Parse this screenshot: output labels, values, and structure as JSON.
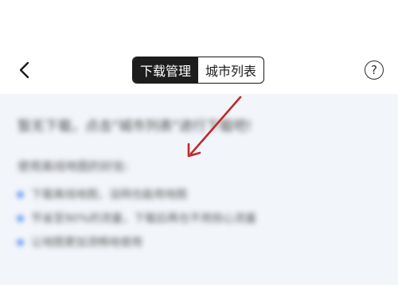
{
  "header": {
    "tabs": [
      {
        "label": "下载管理",
        "active": true
      },
      {
        "label": "城市列表",
        "active": false
      }
    ],
    "back_icon": "chevron-left-icon",
    "help_icon": "question-circle-icon",
    "help_glyph": "?"
  },
  "content": {
    "message": "暂无下载，点击\"城市列表\"进行下载吧!",
    "subtitle": "使用离线地图的好处:",
    "bullets": [
      "下载离线地图，没网也能用地图",
      "节省至90%的流量，下载后再也不用担心流量",
      "让地图更加流畅地使用"
    ]
  },
  "colors": {
    "active_tab_bg": "#1d1d1d",
    "content_bg": "#f2f5fa",
    "bullet": "#4d8df5",
    "annotation_arrow": "#c0282b"
  }
}
